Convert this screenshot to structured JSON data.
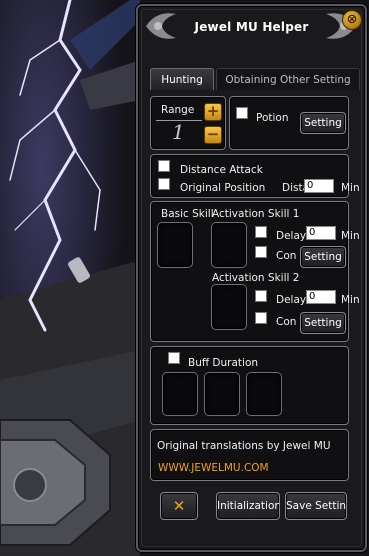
{
  "window": {
    "title": "Jewel MU Helper",
    "close_glyph": "⊗"
  },
  "tabs": [
    {
      "label": "Hunting",
      "active": true
    },
    {
      "label": "Obtaining Other Setting",
      "active": false
    }
  ],
  "range": {
    "label": "Range",
    "value": "1",
    "plus_glyph": "+",
    "minus_glyph": "−"
  },
  "potion": {
    "label": "Potion",
    "setting_label": "Setting"
  },
  "distance": {
    "distance_attack_label": "Distance Attack",
    "original_position_label": "Original Position",
    "dist_label": "Dista",
    "dist_value": "0",
    "min_label": "Min"
  },
  "skills": {
    "basic_label": "Basic Skill",
    "activation1_label": "Activation Skill 1",
    "activation2_label": "Activation Skill 2",
    "delay_label": "Delay",
    "con_label": "Con",
    "delay1_value": "0",
    "delay2_value": "0",
    "min_label": "Min",
    "setting_label": "Setting"
  },
  "buff": {
    "label": "Buff Duration"
  },
  "credits": {
    "text": "Original translations by Jewel MU",
    "link": "WWW.JEWELMU.COM"
  },
  "footer": {
    "cancel_glyph": "✕",
    "init_label": "Initialization",
    "save_label": "Save Setting"
  },
  "colors": {
    "accent_gold": "#f0a11c",
    "panel_border": "#7a7a80",
    "window_bg": "#1a1a1c"
  }
}
